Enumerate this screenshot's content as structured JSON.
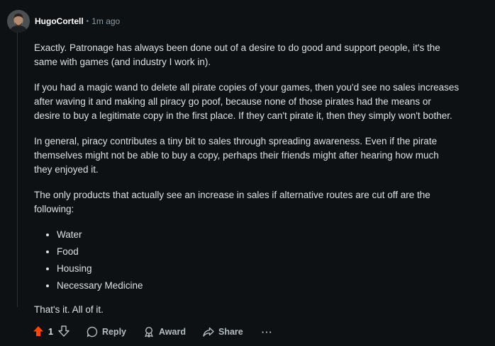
{
  "comment": {
    "author": "HugoCortell",
    "separator": "•",
    "timestamp": "1m ago",
    "paragraphs": [
      "Exactly. Patronage has always been done out of a desire to do good and support people, it's the same with games (and industry I work in).",
      "If you had a magic wand to delete all pirate copies of your games, then you'd see no sales increases after waving it and making all piracy go poof, because none of those pirates had the means or desire to buy a legitimate copy in the first place. If they can't pirate it, then they simply won't bother.",
      "In general, piracy contributes a tiny bit to sales through spreading awareness. Even if the pirate themselves might not be able to buy a copy, perhaps their friends might after hearing how much they enjoyed it.",
      "The only products that actually see an increase in sales if alternative routes are cut off are the following:"
    ],
    "list_items": [
      "Water",
      "Food",
      "Housing",
      "Necessary Medicine"
    ],
    "closing": "That's it. All of it."
  },
  "actions": {
    "upvote_icon": "upvote-arrow-icon",
    "vote_count": "1",
    "downvote_icon": "downvote-arrow-icon",
    "reply_label": "Reply",
    "award_label": "Award",
    "share_label": "Share",
    "more_label": "···"
  },
  "colors": {
    "background": "#0e1113",
    "upvote_active": "#ff4500",
    "text": "#dde1e3",
    "muted": "#b3bcc1"
  }
}
